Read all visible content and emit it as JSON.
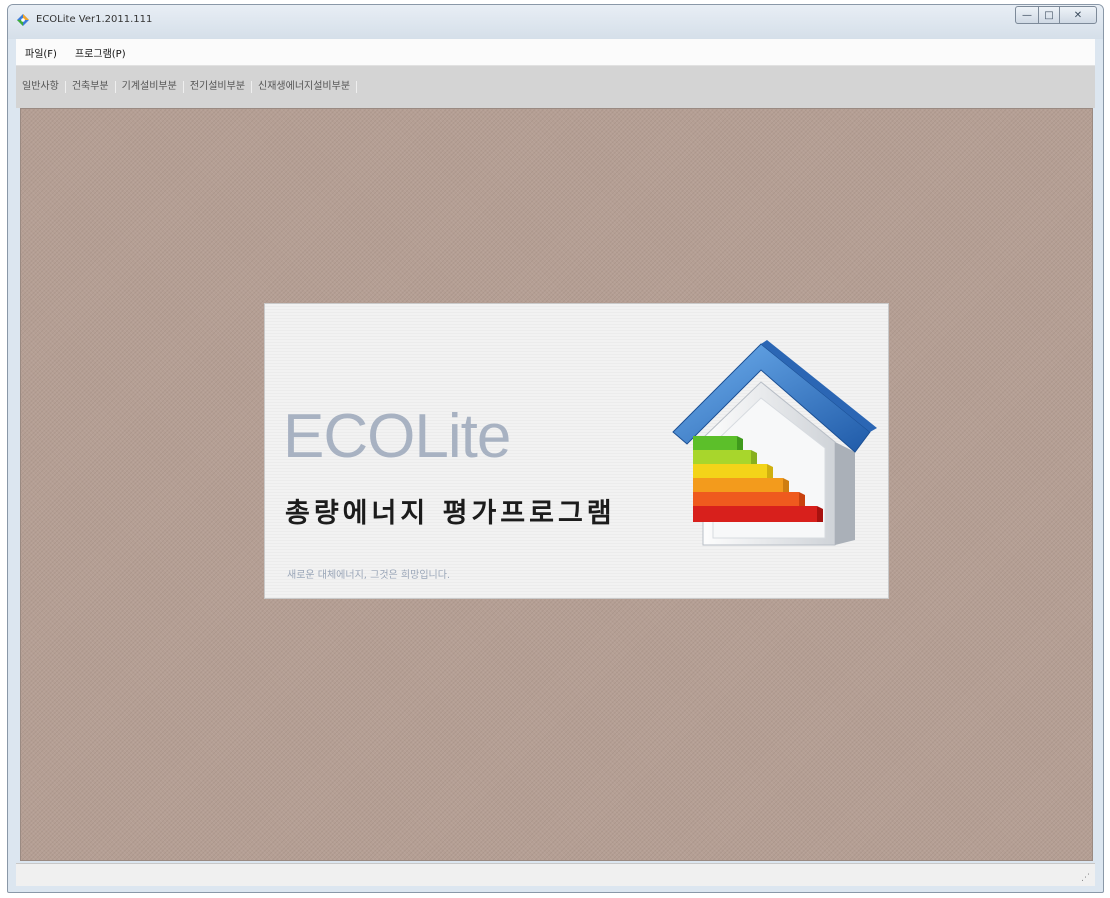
{
  "window": {
    "title": "ECOLite Ver1.2011.111",
    "buttons": {
      "minimize": "—",
      "maximize": "□",
      "close": "✕"
    }
  },
  "menubar": {
    "items": [
      {
        "label": "파일(F)"
      },
      {
        "label": "프로그램(P)"
      }
    ]
  },
  "toolbar": {
    "tabs": [
      {
        "label": "일반사항"
      },
      {
        "label": "건축부분"
      },
      {
        "label": "기계설비부분"
      },
      {
        "label": "전기설비부분"
      },
      {
        "label": "신재생에너지설비부분"
      }
    ]
  },
  "splash": {
    "title": "ECOLite",
    "subtitle": "총량에너지 평가프로그램",
    "tagline": "새로운 대체에너지, 그것은 희망입니다.",
    "colors": {
      "title": "#a8b2c2",
      "roof": "#2f74c4",
      "bars": [
        "#5cbf2a",
        "#a8d62c",
        "#f3d419",
        "#f39b1c",
        "#ef5a1e",
        "#d8201c"
      ]
    }
  },
  "statusbar": {
    "grip": "⋰"
  }
}
